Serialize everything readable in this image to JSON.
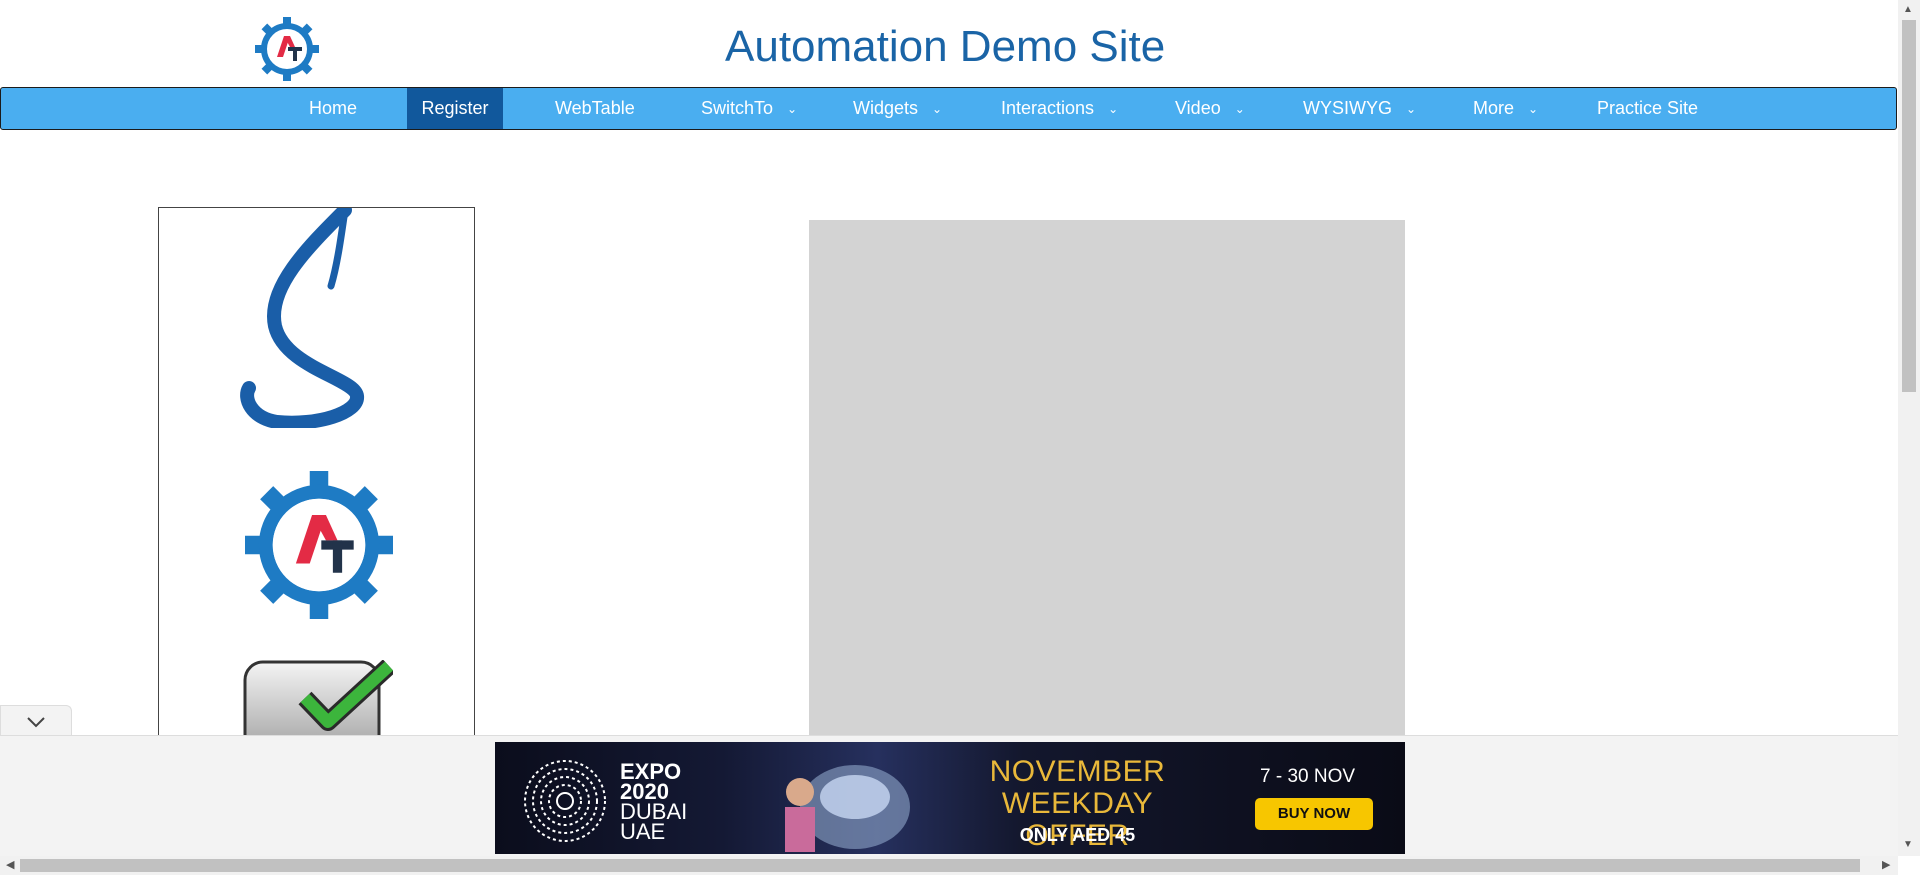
{
  "header": {
    "title": "Automation Demo Site"
  },
  "nav": {
    "items": [
      {
        "label": "Home",
        "has_dropdown": false
      },
      {
        "label": "Register",
        "has_dropdown": false,
        "active": true
      },
      {
        "label": "WebTable",
        "has_dropdown": false
      },
      {
        "label": "SwitchTo",
        "has_dropdown": true
      },
      {
        "label": "Widgets",
        "has_dropdown": true
      },
      {
        "label": "Interactions",
        "has_dropdown": true
      },
      {
        "label": "Video",
        "has_dropdown": true
      },
      {
        "label": "WYSIWYG",
        "has_dropdown": true
      },
      {
        "label": "More",
        "has_dropdown": true
      },
      {
        "label": "Practice Site",
        "has_dropdown": false
      }
    ],
    "dropdown_icon": "chevron-down-icon"
  },
  "left_panel": {
    "icons": [
      "s-logo-icon",
      "at-gear-logo-icon",
      "checkbox-check-icon"
    ]
  },
  "ad": {
    "expo_line1": "EXPO",
    "expo_line2": "2020",
    "expo_line3": "DUBAI",
    "expo_line4": "UAE",
    "offer_line1": "NOVEMBER",
    "offer_line2": "WEEKDAY OFFER",
    "price": "ONLY AED 45",
    "dates": "7 - 30 NOV",
    "cta": "BUY NOW"
  },
  "colors": {
    "title": "#1a64a6",
    "nav_bg": "#4aaef0",
    "nav_active": "#11589c",
    "offer_gold": "#e9b83a",
    "cta_yellow": "#f7c600"
  }
}
